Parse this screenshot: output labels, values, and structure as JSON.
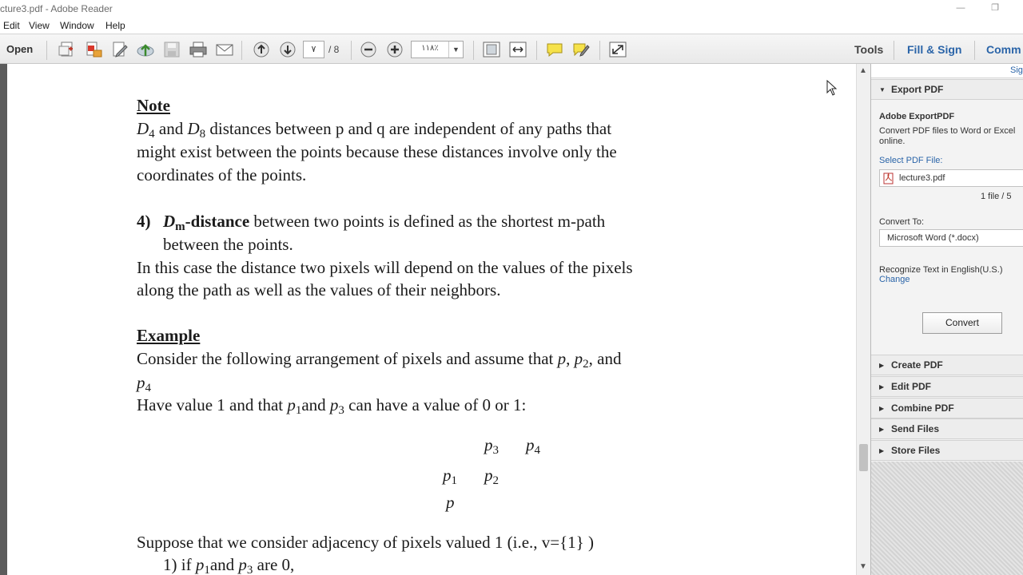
{
  "window": {
    "title": "cture3.pdf - Adobe Reader",
    "minimize_glyph": "—",
    "restore_glyph": "❐"
  },
  "menu": [
    "Edit",
    "View",
    "Window",
    "Help"
  ],
  "toolbar": {
    "open_label": "Open",
    "page_current": "٧",
    "page_total": "/ 8",
    "zoom": "١١٨٪",
    "zoom_dropdown": "▼",
    "tools_label": "Tools",
    "fill_sign_label": "Fill & Sign",
    "comment_label": "Comm",
    "icons": [
      "create-pdf-icon",
      "export-pdf-icon",
      "edit-icon",
      "upload-icon",
      "save-icon",
      "print-icon",
      "email-icon",
      "previous-page-icon",
      "next-page-icon",
      "zoom-out-icon",
      "zoom-in-icon",
      "fit-page-icon",
      "fit-width-icon",
      "comment-icon",
      "highlight-icon",
      "fullscreen-icon"
    ]
  },
  "document": {
    "note_heading": "Note",
    "note_lines": {
      "l1_d4": "D",
      "l1_d4_sub": "4",
      "l1_and": " and ",
      "l1_d8": "D",
      "l1_d8_sub": "8",
      "l1_rest": " distances between p and q are independent of any paths that",
      "l2": "might exist  between the points because these distances involve only the",
      "l3": "coordinates of the points."
    },
    "item4": {
      "number": "4)",
      "d": "D",
      "d_sub": "m",
      "term": "-distance",
      "rest": " between two points is defined as the shortest m-path",
      "line2": "between the points."
    },
    "para_lines": [
      "In this case the distance two pixels  will  depend on the values of the pixels",
      "along the path as well as the values of their neighbors."
    ],
    "example_heading": "Example",
    "example": {
      "l1_a": "Consider the following  arrangement of pixels  and assume that ",
      "l1_p": "p",
      "l1_c": ", ",
      "l1_p2": "p",
      "l1_p2_sub": "2",
      "l1_end": ", and",
      "l2_p": "p",
      "l2_sub": "4",
      "l3_a": "Have value  1 and that ",
      "l3_p1": "p",
      "l3_p1_sub": "1",
      "l3_and": "and ",
      "l3_p3": "p",
      "l3_p3_sub": "3",
      "l3_end": "  can have a value of 0  or 1:"
    },
    "grid": {
      "p3": "p",
      "p3_sub": "3",
      "p4": "p",
      "p4_sub": "4",
      "p1": "p",
      "p1_sub": "1",
      "p2": "p",
      "p2_sub": "2",
      "p": "p"
    },
    "suppose_line": "Suppose that we consider adjacency of pixels  valued 1 (i.e., v={1} )",
    "case1": {
      "a": "1)  if ",
      "p1": "p",
      "p1_sub": "1",
      "and": "and ",
      "p3": "p",
      "p3_sub": "3",
      "end": "  are 0,"
    }
  },
  "right_pane": {
    "sign_label": "Sig",
    "export_header": "Export PDF",
    "export_title": "Adobe ExportPDF",
    "export_desc_1": "Convert PDF files to Word or Excel",
    "export_desc_2": "online.",
    "select_label": "Select PDF File:",
    "file_name": "lecture3.pdf",
    "file_count": "1 file / 5",
    "convert_to_label": "Convert To:",
    "convert_to_value": "Microsoft Word (*.docx)",
    "recognize_text": "Recognize Text in English(U.S.)",
    "change_link": "Change",
    "convert_button": "Convert",
    "sections": [
      "Create PDF",
      "Edit PDF",
      "Combine PDF",
      "Send Files",
      "Store Files"
    ]
  },
  "colors": {
    "link_blue": "#2a64a8",
    "toolbar_bg": "#ececec",
    "doc_text": "#1b1b1b"
  }
}
